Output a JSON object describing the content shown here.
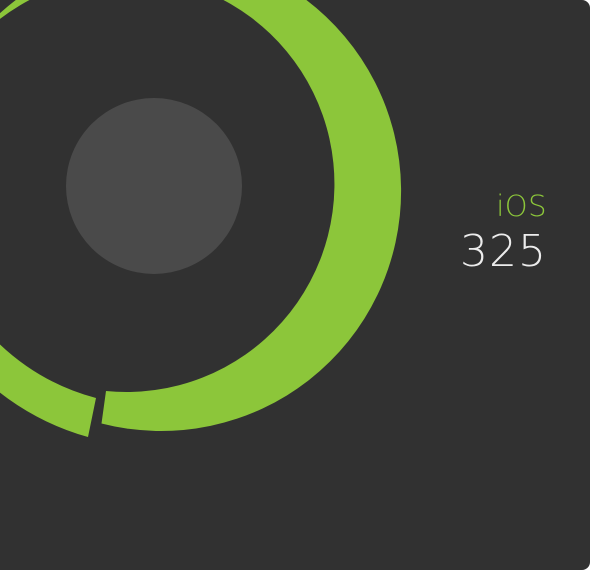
{
  "metric": {
    "label": "iOS",
    "value": "325"
  },
  "colors": {
    "background": "#313131",
    "accent": "#8cc63a",
    "center_circle": "#4a4a4a",
    "value_text": "#ececec"
  },
  "ring": {
    "segment_count": 2
  }
}
